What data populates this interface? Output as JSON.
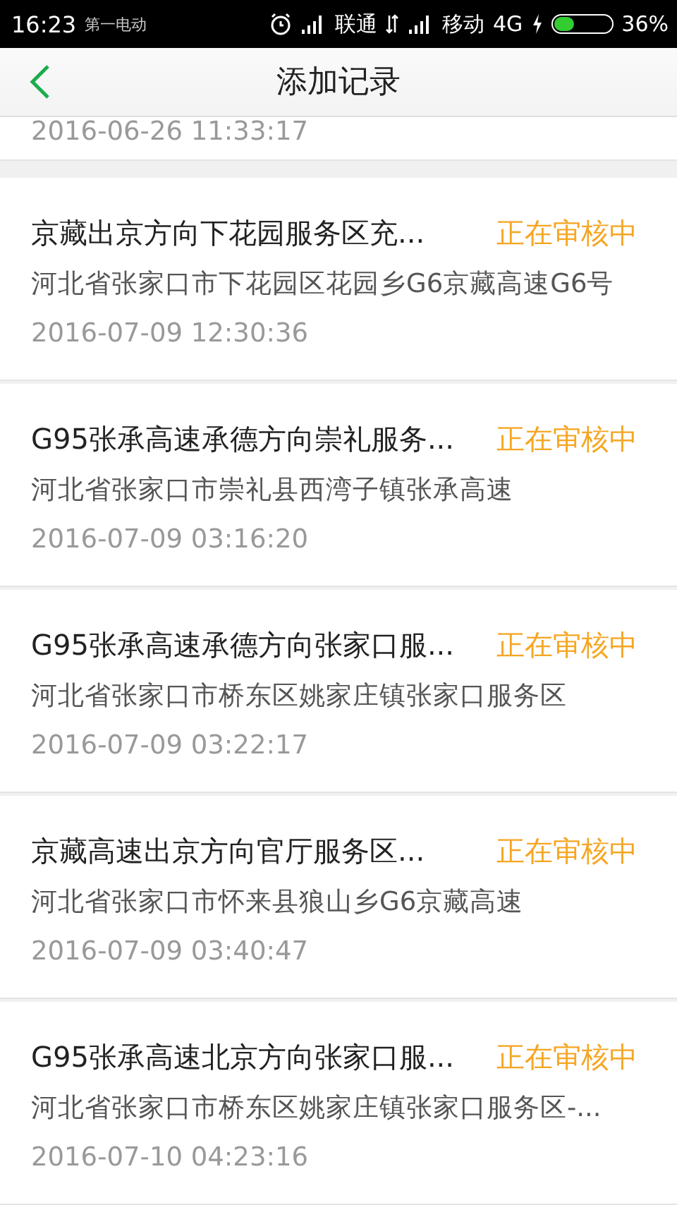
{
  "status_bar": {
    "time": "16:23",
    "notification": "第一电动",
    "carrier_1": "联通",
    "carrier_2": "移动",
    "network": "4G",
    "battery": "36%"
  },
  "header": {
    "title": "添加记录"
  },
  "partial_record": {
    "time": "2016-06-26 11:33:17"
  },
  "records": [
    {
      "title": "京藏出京方向下花园服务区充...",
      "status": "正在审核中",
      "address": "河北省张家口市下花园区花园乡G6京藏高速G6号",
      "time": "2016-07-09 12:30:36"
    },
    {
      "title": "G95张承高速承德方向崇礼服务...",
      "status": "正在审核中",
      "address": "河北省张家口市崇礼县西湾子镇张承高速",
      "time": "2016-07-09 03:16:20"
    },
    {
      "title": "G95张承高速承德方向张家口服...",
      "status": "正在审核中",
      "address": "河北省张家口市桥东区姚家庄镇张家口服务区",
      "time": "2016-07-09 03:22:17"
    },
    {
      "title": "京藏高速出京方向官厅服务区...",
      "status": "正在审核中",
      "address": "河北省张家口市怀来县狼山乡G6京藏高速",
      "time": "2016-07-09 03:40:47"
    },
    {
      "title": "G95张承高速北京方向张家口服...",
      "status": "正在审核中",
      "address": "河北省张家口市桥东区姚家庄镇张家口服务区-...",
      "time": "2016-07-10 04:23:16"
    }
  ]
}
